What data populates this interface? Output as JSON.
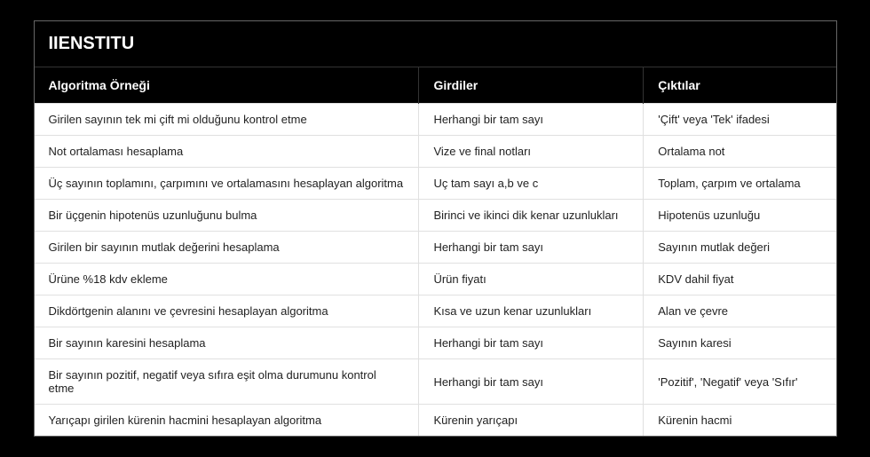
{
  "title": "IIENSTITU",
  "headers": {
    "example": "Algoritma Örneği",
    "inputs": "Girdiler",
    "outputs": "Çıktılar"
  },
  "chart_data": {
    "type": "table",
    "columns": [
      "Algoritma Örneği",
      "Girdiler",
      "Çıktılar"
    ],
    "rows": [
      {
        "example": "Girilen sayının tek mi çift mi olduğunu kontrol etme",
        "inputs": "Herhangi bir tam sayı",
        "outputs": "'Çift' veya 'Tek' ifadesi"
      },
      {
        "example": "Not ortalaması hesaplama",
        "inputs": "Vize ve final notları",
        "outputs": "Ortalama not"
      },
      {
        "example": "Üç sayının toplamını, çarpımını ve ortalamasını hesaplayan algoritma",
        "inputs": "Uç tam sayı a,b ve c",
        "outputs": "Toplam, çarpım ve ortalama"
      },
      {
        "example": "Bir üçgenin hipotenüs uzunluğunu bulma",
        "inputs": "Birinci ve ikinci dik kenar uzunlukları",
        "outputs": "Hipotenüs uzunluğu"
      },
      {
        "example": "Girilen bir sayının mutlak değerini hesaplama",
        "inputs": "Herhangi bir tam sayı",
        "outputs": "Sayının mutlak değeri"
      },
      {
        "example": "Ürüne %18 kdv ekleme",
        "inputs": "Ürün fiyatı",
        "outputs": "KDV dahil fiyat"
      },
      {
        "example": "Dikdörtgenin alanını ve çevresini hesaplayan algoritma",
        "inputs": "Kısa ve uzun kenar uzunlukları",
        "outputs": "Alan ve çevre"
      },
      {
        "example": "Bir sayının karesini hesaplama",
        "inputs": "Herhangi bir tam sayı",
        "outputs": "Sayının karesi"
      },
      {
        "example": "Bir sayının pozitif, negatif veya sıfıra eşit olma durumunu kontrol etme",
        "inputs": "Herhangi bir tam sayı",
        "outputs": "'Pozitif', 'Negatif' veya 'Sıfır'"
      },
      {
        "example": "Yarıçapı girilen kürenin hacmini hesaplayan algoritma",
        "inputs": "Kürenin yarıçapı",
        "outputs": "Kürenin hacmi"
      }
    ]
  }
}
